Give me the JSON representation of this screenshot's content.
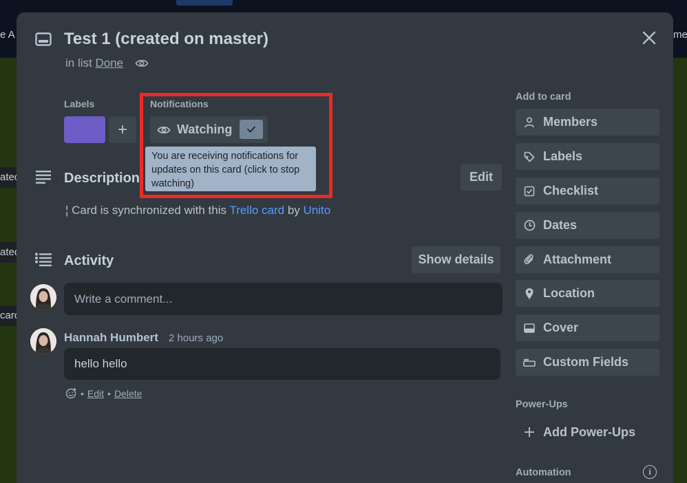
{
  "card": {
    "title": "Test 1 (created on master)",
    "in_list_prefix": "in list",
    "list_name": "Done"
  },
  "labels": {
    "heading": "Labels",
    "add": "+",
    "chip_color": "#6e5dc6"
  },
  "notifications": {
    "heading": "Notifications",
    "watch_label": "Watching",
    "check": "✓",
    "tooltip": "You are receiving notifications for updates on this card (click to stop watching)"
  },
  "description": {
    "title": "Description",
    "edit_label": "Edit",
    "text_prefix": "¦ Card is synchronized with this",
    "link1": "Trello card",
    "text_mid": "by",
    "link2": "Unito"
  },
  "activity": {
    "title": "Activity",
    "show_details_label": "Show details",
    "comment_placeholder": "Write a comment...",
    "comments": [
      {
        "author": "Hannah Humbert",
        "time": "2 hours ago",
        "text": "hello hello",
        "edit": "Edit",
        "delete": "Delete",
        "sep": "•"
      }
    ]
  },
  "sidebar": {
    "add_to_card": "Add to card",
    "items": [
      {
        "label": "Members",
        "icon": "person-icon"
      },
      {
        "label": "Labels",
        "icon": "tag-icon"
      },
      {
        "label": "Checklist",
        "icon": "checkbox-icon"
      },
      {
        "label": "Dates",
        "icon": "clock-icon"
      },
      {
        "label": "Attachment",
        "icon": "paperclip-icon"
      },
      {
        "label": "Location",
        "icon": "pin-icon"
      },
      {
        "label": "Cover",
        "icon": "cover-icon"
      },
      {
        "label": "Custom Fields",
        "icon": "fields-icon"
      }
    ],
    "powerups_heading": "Power-Ups",
    "add_powerups": "Add Power-Ups",
    "automation_heading": "Automation"
  },
  "background": {
    "left_fragments": [
      "e A",
      "ated",
      "ated",
      "card"
    ],
    "right_fragment": "me"
  },
  "colors": {
    "accent_link": "#579dff",
    "highlight": "#ee2a24",
    "modal_bg": "#323940"
  }
}
